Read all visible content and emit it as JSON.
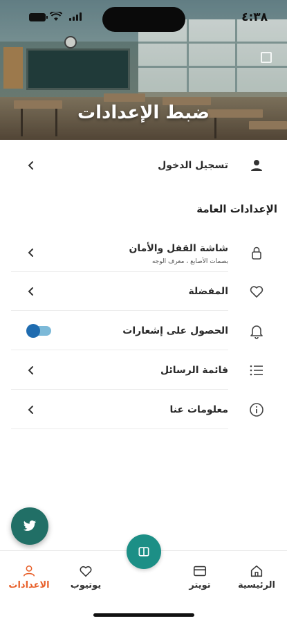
{
  "status_bar": {
    "time": "٤:٣٨"
  },
  "header": {
    "title": "ضبط الإعدادات"
  },
  "login": {
    "label": "تسجيل الدخول"
  },
  "general": {
    "title": "الإعدادات العامة",
    "items": [
      {
        "label": "شاشة القفل والأمان",
        "sub": "بصمات الأصابع ، معرف الوجه",
        "icon": "lock-icon"
      },
      {
        "label": "المفضلة",
        "icon": "heart-icon"
      },
      {
        "label": "الحصول على إشعارات",
        "icon": "bell-icon",
        "toggle_on": true
      },
      {
        "label": "قائمة الرسائل",
        "icon": "list-icon"
      },
      {
        "label": "معلومات عنا",
        "icon": "info-icon"
      }
    ]
  },
  "bottom_nav": {
    "items": [
      {
        "label": "الرئيسية",
        "icon": "home-icon"
      },
      {
        "label": "تويتر",
        "icon": "card-icon"
      },
      {
        "label": "يوتيوب",
        "icon": "heart-icon"
      },
      {
        "label": "الاعدادات",
        "icon": "person-icon",
        "active": true
      }
    ]
  },
  "colors": {
    "accent": "#e8602a",
    "teal": "#1c8f86",
    "toggle": "#1f6cb0"
  }
}
